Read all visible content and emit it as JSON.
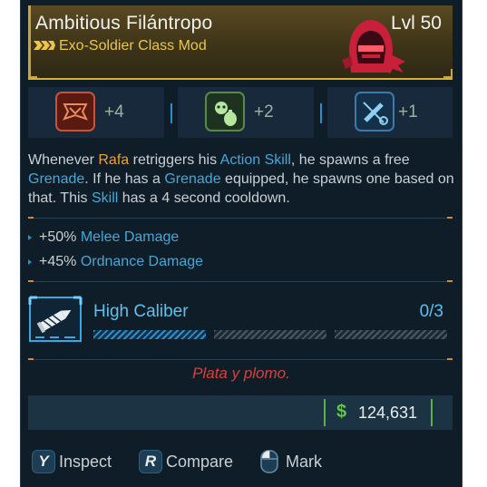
{
  "item": {
    "name": "Ambitious Filántropo",
    "level": "Lvl 50",
    "class_mod": "Exo-Soldier Class Mod",
    "rarity_icon": "legendary-chevrons-icon",
    "emblem_icon": "hooded-skull-emblem-icon",
    "rarity_color": "#e9c64a",
    "emblem_color": "#c8203a"
  },
  "skills": [
    {
      "icon": "banner-skill-icon",
      "bonus": "+4"
    },
    {
      "icon": "grenade-skill-icon",
      "bonus": "+2"
    },
    {
      "icon": "syringe-skill-icon",
      "bonus": "+1"
    }
  ],
  "description": {
    "p1": "Whenever ",
    "rafa": "Rafa",
    "p2": " retriggers his ",
    "action_skill": "Action Skill",
    "p3": ", he spawns a free ",
    "grenade1": "Grenade",
    "p4": ". If he has a ",
    "grenade2": "Grenade",
    "p5": " equipped, he spawns one based on that. This ",
    "skill": "Skill",
    "p6": " has a 4 second cooldown."
  },
  "stats": [
    {
      "value": "+50%",
      "label": "Melee Damage"
    },
    {
      "value": "+45%",
      "label": "Ordnance Damage"
    }
  ],
  "perk": {
    "name": "High Caliber",
    "rank": "0/3",
    "icon": "bullet-cartridge-icon"
  },
  "flavor_text": "Plata y plomo.",
  "price": {
    "symbol": "$",
    "value": "124,631",
    "color": "#66c24f"
  },
  "footer": [
    {
      "key": "Y",
      "label": "Inspect"
    },
    {
      "key": "R",
      "label": "Compare"
    },
    {
      "key": "",
      "label": "Mark",
      "icon": "mouse-icon"
    }
  ]
}
